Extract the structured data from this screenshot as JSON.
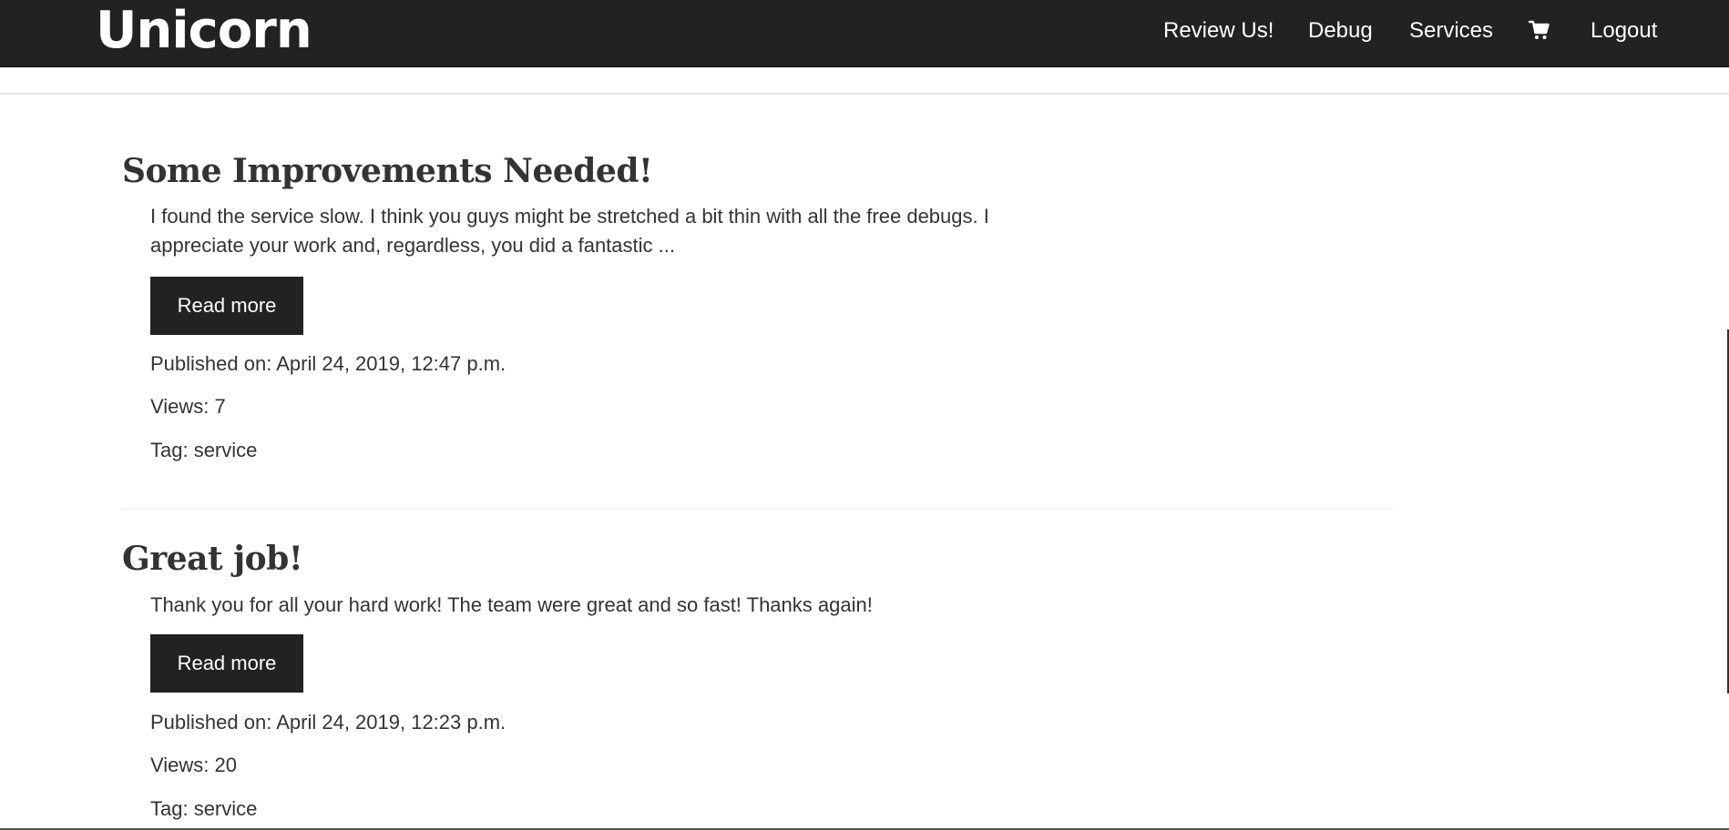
{
  "navbar": {
    "brand": "Unicorn",
    "items": [
      {
        "label": "Review Us!"
      },
      {
        "label": "Debug"
      },
      {
        "label": "Services"
      },
      {
        "label": "Logout"
      }
    ],
    "cart_icon": "cart-icon"
  },
  "reviews": [
    {
      "title": "Some Improvements Needed!",
      "excerpt": "I found the service slow. I think you guys might be stretched a bit thin with all the free debugs. I appreciate your work and, regardless, you did a fantastic ...",
      "read_more": "Read more",
      "published": "Published on: April 24, 2019, 12:47 p.m.",
      "views": "Views: 7",
      "tag": "Tag: service"
    },
    {
      "title": "Great job!",
      "excerpt": "Thank you for all your hard work! The team were great and so fast! Thanks again!",
      "read_more": "Read more",
      "published": "Published on: April 24, 2019, 12:23 p.m.",
      "views": "Views: 20",
      "tag": "Tag: service"
    }
  ],
  "colors": {
    "navbar_bg": "#222222",
    "button_bg": "#222222",
    "text": "#333333"
  }
}
